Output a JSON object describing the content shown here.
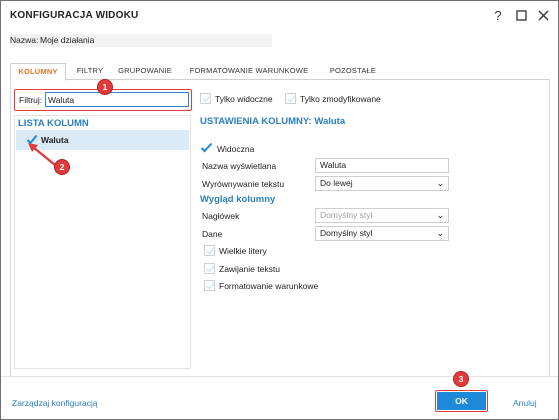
{
  "window": {
    "title": "KONFIGURACJA WIDOKU",
    "help_icon": "question-mark-icon",
    "maximize_icon": "maximize-icon",
    "close_icon": "close-icon"
  },
  "name_row": {
    "label": "Nazwa:",
    "value": "Moje działania"
  },
  "tabs": [
    {
      "label": "KOLUMNY",
      "active": true
    },
    {
      "label": "FILTRY",
      "active": false
    },
    {
      "label": "GRUPOWANIE",
      "active": false
    },
    {
      "label": "FORMATOWANIE WARUNKOWE",
      "active": false
    },
    {
      "label": "POZOSTAŁE",
      "active": false
    }
  ],
  "filter": {
    "label": "Filtruj:",
    "value": "Waluta"
  },
  "top_checkboxes": [
    {
      "label": "Tylko widoczne",
      "checked": false
    },
    {
      "label": "Tylko zmodyfikowane",
      "checked": false
    }
  ],
  "column_list": {
    "title": "LISTA KOLUMN",
    "items": [
      {
        "label": "Waluta",
        "checked": true,
        "selected": true
      }
    ]
  },
  "column_settings": {
    "title": "USTAWIENIA KOLUMNY: Waluta",
    "visible": {
      "label": "Widoczna",
      "checked": true
    },
    "display_name": {
      "label": "Nazwa wyświetlana",
      "value": "Waluta"
    },
    "text_align": {
      "label": "Wyrównywanie tekstu",
      "value": "Do lewej"
    },
    "appearance_title": "Wygląd kolumny",
    "header": {
      "label": "Nagłówek",
      "value": "Domyślny styl",
      "disabled": true
    },
    "data": {
      "label": "Dane",
      "value": "Domyślny styl",
      "disabled": false
    },
    "options": [
      {
        "label": "Wielkie litery",
        "checked": false
      },
      {
        "label": "Zawijanie tekstu",
        "checked": false
      },
      {
        "label": "Formatowanie warunkowe",
        "checked": false
      }
    ]
  },
  "footer": {
    "manage_label": "Zarządzaj konfiguracją",
    "ok_label": "OK",
    "cancel_label": "Anuluj"
  },
  "annotations": [
    "1",
    "2",
    "3"
  ],
  "colors": {
    "accent_blue": "#2b7fc0",
    "tab_active": "#e8752a",
    "ok_button": "#1e88d9",
    "highlight_red": "#e23b3b",
    "selected_row": "#daeaf7"
  }
}
